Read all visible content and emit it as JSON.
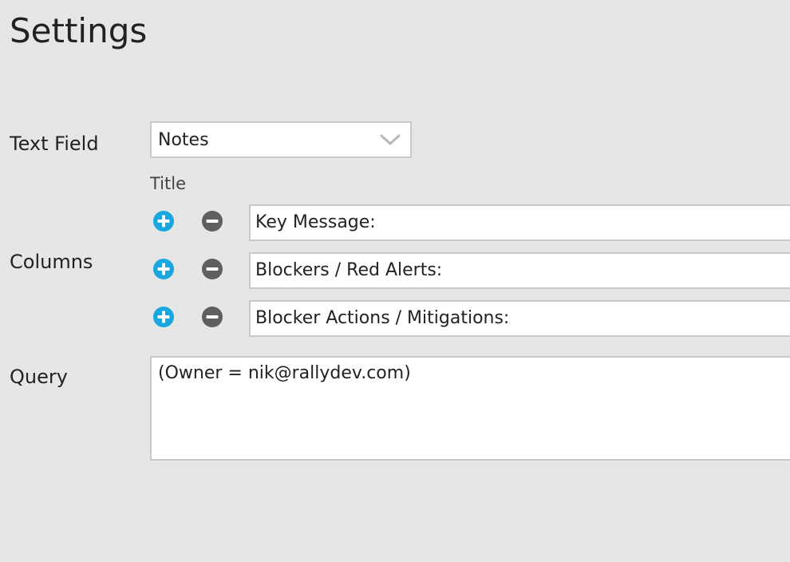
{
  "page": {
    "title": "Settings"
  },
  "text_field": {
    "label": "Text Field",
    "selected": "Notes"
  },
  "columns": {
    "label": "Columns",
    "header": "Title",
    "items": [
      {
        "title": "Key Message:"
      },
      {
        "title": "Blockers / Red Alerts:"
      },
      {
        "title": "Blocker Actions / Mitigations:"
      }
    ]
  },
  "query": {
    "label": "Query",
    "value": "(Owner = nik@rallydev.com)"
  },
  "icons": {
    "add": "plus-circle-icon",
    "remove": "minus-circle-icon",
    "dropdown": "chevron-down-icon"
  },
  "colors": {
    "add_icon": "#1aa7e0",
    "remove_icon": "#5f5f5f",
    "background": "#e6e6e6",
    "input_border": "#c8c8c8"
  }
}
